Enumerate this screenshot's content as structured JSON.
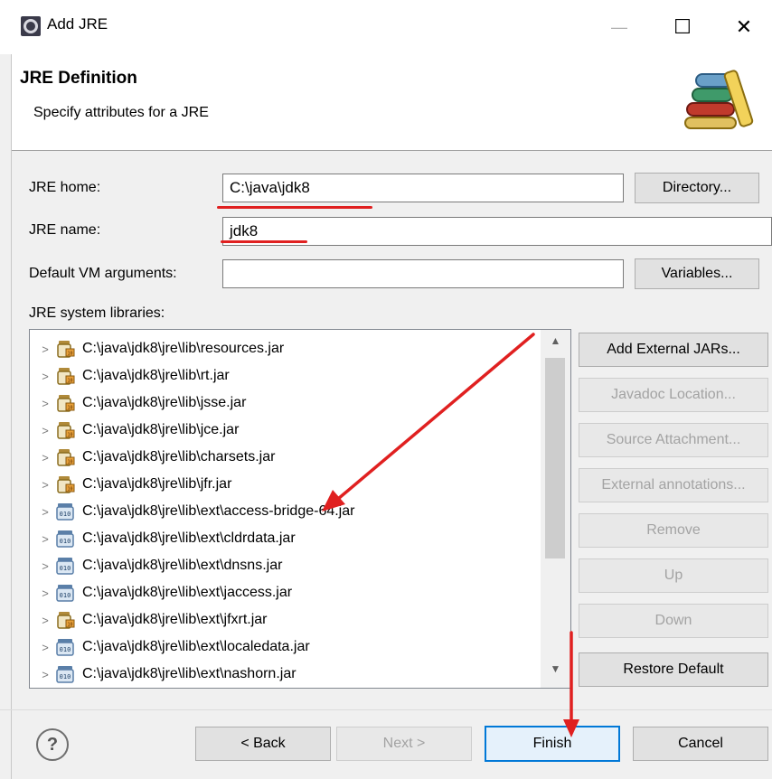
{
  "window": {
    "title": "Add JRE",
    "minimize_glyph": "—",
    "maximize_glyph": "☐",
    "close_glyph": "✕",
    "icon": "eclipse-icon"
  },
  "header": {
    "title": "JRE Definition",
    "subtitle": "Specify attributes for a JRE",
    "icon": "books-icon"
  },
  "form": {
    "jre_home_label": "JRE home:",
    "jre_home_value": "C:\\java\\jdk8",
    "directory_button": "Directory...",
    "jre_name_label": "JRE name:",
    "jre_name_value": "jdk8",
    "vm_args_label": "Default VM arguments:",
    "vm_args_value": "",
    "variables_button": "Variables...",
    "libraries_label": "JRE system libraries:"
  },
  "libraries": [
    {
      "path": "C:\\java\\jdk8\\jre\\lib\\resources.jar",
      "icon": "jar-icon"
    },
    {
      "path": "C:\\java\\jdk8\\jre\\lib\\rt.jar",
      "icon": "jar-icon"
    },
    {
      "path": "C:\\java\\jdk8\\jre\\lib\\jsse.jar",
      "icon": "jar-icon"
    },
    {
      "path": "C:\\java\\jdk8\\jre\\lib\\jce.jar",
      "icon": "jar-icon"
    },
    {
      "path": "C:\\java\\jdk8\\jre\\lib\\charsets.jar",
      "icon": "jar-icon"
    },
    {
      "path": "C:\\java\\jdk8\\jre\\lib\\jfr.jar",
      "icon": "jar-icon"
    },
    {
      "path": "C:\\java\\jdk8\\jre\\lib\\ext\\access-bridge-64.jar",
      "icon": "binary-jar-icon"
    },
    {
      "path": "C:\\java\\jdk8\\jre\\lib\\ext\\cldrdata.jar",
      "icon": "binary-jar-icon"
    },
    {
      "path": "C:\\java\\jdk8\\jre\\lib\\ext\\dnsns.jar",
      "icon": "binary-jar-icon"
    },
    {
      "path": "C:\\java\\jdk8\\jre\\lib\\ext\\jaccess.jar",
      "icon": "binary-jar-icon"
    },
    {
      "path": "C:\\java\\jdk8\\jre\\lib\\ext\\jfxrt.jar",
      "icon": "jar-icon"
    },
    {
      "path": "C:\\java\\jdk8\\jre\\lib\\ext\\localedata.jar",
      "icon": "binary-jar-icon"
    },
    {
      "path": "C:\\java\\jdk8\\jre\\lib\\ext\\nashorn.jar",
      "icon": "binary-jar-icon"
    }
  ],
  "side_buttons": {
    "add_external_jars": "Add External JARs...",
    "javadoc_location": "Javadoc Location...",
    "source_attachment": "Source Attachment...",
    "external_annotations": "External annotations...",
    "remove": "Remove",
    "up": "Up",
    "down": "Down",
    "restore_default": "Restore Default"
  },
  "footer": {
    "help": "?",
    "back": "< Back",
    "next": "Next >",
    "finish": "Finish",
    "cancel": "Cancel"
  },
  "colors": {
    "annotation_red": "#e02020",
    "focus_blue": "#0078d7"
  }
}
